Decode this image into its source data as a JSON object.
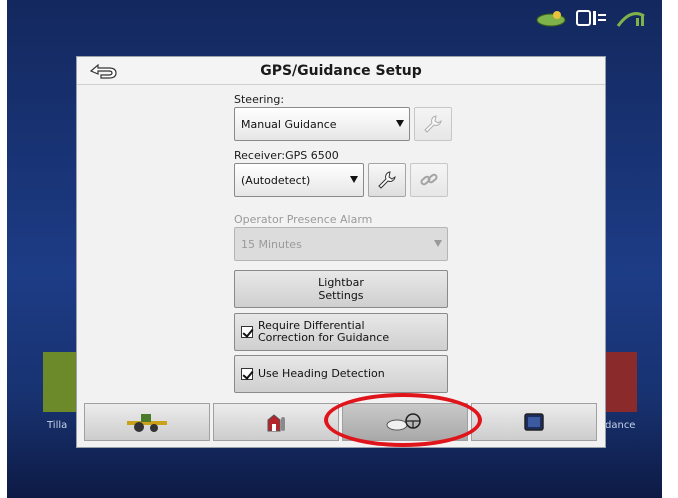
{
  "dialog": {
    "title": "GPS/Guidance Setup"
  },
  "steering": {
    "label": "Steering:",
    "value": "Manual Guidance"
  },
  "receiver": {
    "label": "Receiver:GPS 6500",
    "value": "(Autodetect)"
  },
  "alarm": {
    "label": "Operator Presence Alarm",
    "value": "15 Minutes"
  },
  "lightbar": {
    "line1": "Lightbar",
    "line2": "Settings"
  },
  "differential": {
    "line1": "Require Differential",
    "line2": "Correction for Guidance",
    "checked": true
  },
  "heading": {
    "label": "Use Heading Detection",
    "checked": true
  },
  "background": {
    "left_label": "Tilla",
    "right_label": "dance"
  },
  "bottom_tabs": [
    {
      "icon": "tractor-icon"
    },
    {
      "icon": "farm-icon"
    },
    {
      "icon": "steering-wheel-icon",
      "active": true
    },
    {
      "icon": "display-icon"
    }
  ],
  "colors": {
    "highlight": "#e0151b",
    "screen_bg": "#1d3c86"
  }
}
